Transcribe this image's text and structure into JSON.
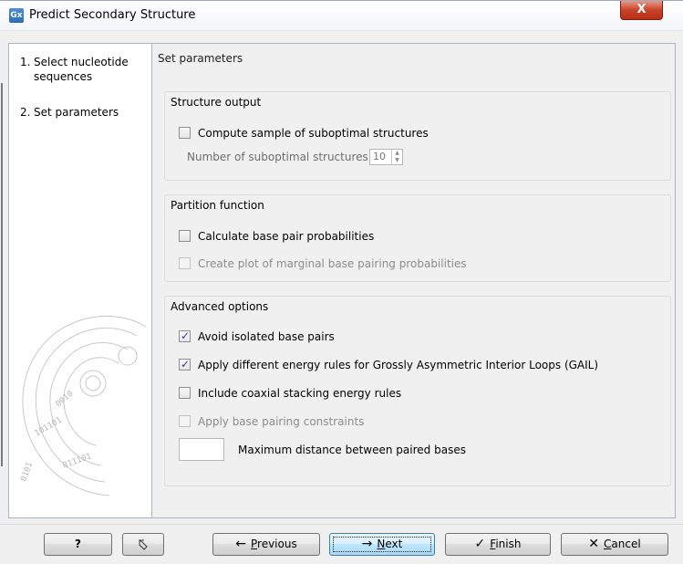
{
  "window": {
    "icon_text": "Gx",
    "title": "Predict Secondary Structure",
    "close_label": "X"
  },
  "sidebar": {
    "steps": [
      {
        "num": "1.",
        "label": "Select nucleotide sequences"
      },
      {
        "num": "2.",
        "label": "Set parameters"
      }
    ]
  },
  "content": {
    "title": "Set parameters",
    "structure_output": {
      "title": "Structure output",
      "compute_sample": {
        "label": "Compute sample of suboptimal structures",
        "checked": false
      },
      "number_label": "Number of suboptimal structures:",
      "number_value": "10"
    },
    "partition_function": {
      "title": "Partition function",
      "calc_base_pair": {
        "label": "Calculate base pair probabilities",
        "checked": false
      },
      "create_plot": {
        "label": "Create plot of marginal base pairing probabilities",
        "checked": false,
        "disabled": true
      }
    },
    "advanced_options": {
      "title": "Advanced options",
      "avoid_isolated": {
        "label": "Avoid isolated base pairs",
        "checked": true
      },
      "apply_gail": {
        "label": "Apply different energy rules for Grossly Asymmetric Interior Loops (GAIL)",
        "checked": true
      },
      "include_coaxial": {
        "label": "Include coaxial stacking energy rules",
        "checked": false
      },
      "apply_constraints": {
        "label": "Apply base pairing constraints",
        "checked": false,
        "disabled": true
      },
      "max_distance_label": "Maximum distance between paired bases",
      "max_distance_value": ""
    }
  },
  "footer": {
    "help_label": "?",
    "reset_icon": "reset-arrow-icon",
    "previous": {
      "prefix": "",
      "underlined": "P",
      "rest": "revious"
    },
    "next": {
      "underlined": "N",
      "rest": "ext"
    },
    "finish": {
      "underlined": "F",
      "rest": "inish"
    },
    "cancel": {
      "underlined": "C",
      "rest": "ancel"
    }
  },
  "colors": {
    "title_bar": "#f3f5f8",
    "close_button": "#c8432a",
    "default_button": "#bee6fd",
    "checkbox_mark": "#2a3f9c"
  }
}
